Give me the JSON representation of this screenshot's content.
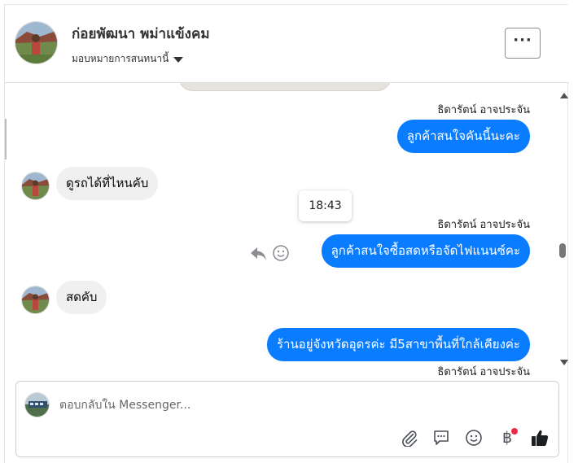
{
  "header": {
    "name": "ก่อยพัฒนา พม่าแข้งคม",
    "assign_label": "มอบหมายการสนทนานี้",
    "icons": {
      "more": "more-options-icon",
      "caret": "caret-down-icon"
    }
  },
  "messages": [
    {
      "type": "outgoing",
      "sender": "ธิดารัตน์ อาจประจัน",
      "text": "ลูกค้าสนใจคันนี้นะคะ"
    },
    {
      "type": "incoming",
      "text": "ดูรถได้ที่ไหนคับ"
    },
    {
      "type": "timestamp",
      "text": "18:43"
    },
    {
      "type": "outgoing",
      "sender": "ธิดารัตน์ อาจประจัน",
      "text": "ลูกค้าสนใจซื้อสดหรือจัดไฟแนนซ์คะ"
    },
    {
      "type": "incoming",
      "text": "สดคับ"
    },
    {
      "type": "outgoing",
      "text": "ร้านอยู่จังหวัดอุดรค่ะ มี5สาขาพื้นที่ใกล้เคียงค่ะ"
    },
    {
      "type": "sender-label",
      "sender": "ธิดารัตน์ อาจประจัน"
    }
  ],
  "composer": {
    "placeholder": "ตอบกลับใน Messenger...",
    "tools": [
      "paperclip-icon",
      "saved-reply-icon",
      "emoji-icon",
      "baht-payment-icon",
      "thumbs-up-icon"
    ],
    "baht_symbol": "฿"
  },
  "colors": {
    "accent": "#0a7cff",
    "incoming_bubble": "#f0f0f0",
    "notification": "#f02849"
  }
}
